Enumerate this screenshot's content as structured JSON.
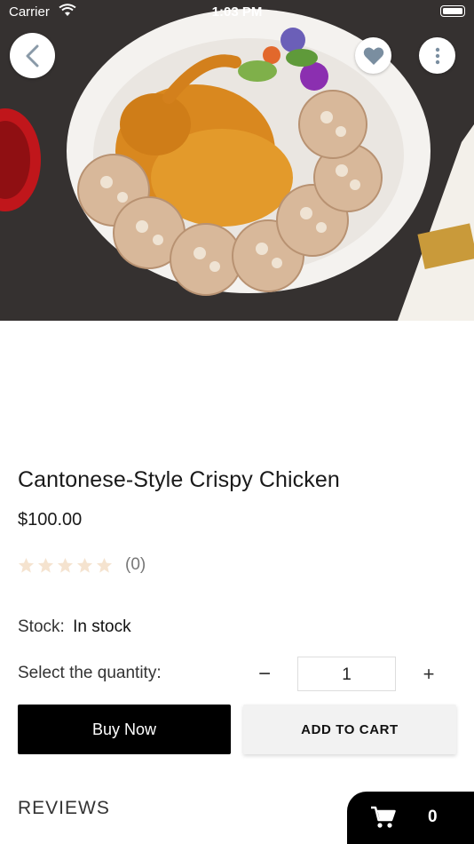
{
  "status_bar": {
    "carrier": "Carrier",
    "time": "1:03 PM"
  },
  "hero": {
    "image_icon": "food-photo",
    "back_icon": "chevron-left-icon",
    "favorite_icon": "heart-icon",
    "more_icon": "more-vertical-icon"
  },
  "product": {
    "title": "Cantonese-Style Crispy Chicken",
    "price": "$100.00",
    "rating": {
      "value": 0,
      "max": 5,
      "count_label": "(0)"
    },
    "stock_label": "Stock:",
    "stock_value": "In stock"
  },
  "quantity": {
    "label": "Select the quantity:",
    "minus": "−",
    "value": "1",
    "plus": "+"
  },
  "actions": {
    "buy_now": "Buy Now",
    "add_to_cart": "ADD TO CART"
  },
  "reviews": {
    "heading": "REVIEWS"
  },
  "floating_cart": {
    "icon": "cart-icon",
    "count": "0"
  },
  "colors": {
    "accent": "#000000",
    "star_empty": "#f5e3cf",
    "heart": "#7a8ea0"
  }
}
